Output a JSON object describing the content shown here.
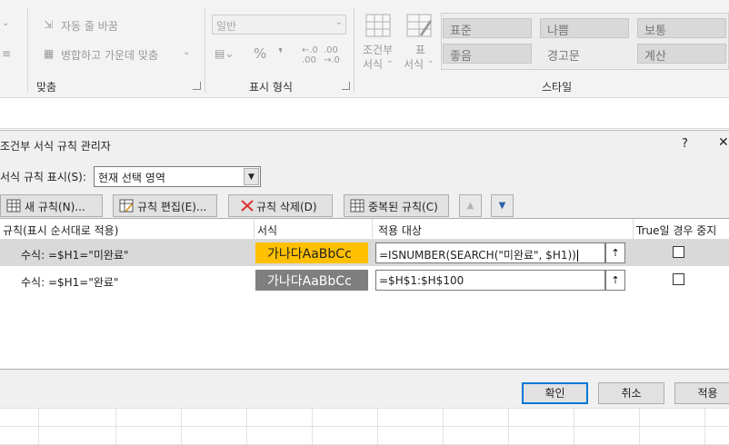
{
  "ribbon": {
    "alignment": {
      "wrap_text": "자동 줄 바꿈",
      "merge_center": "병합하고 가운데 맞춤",
      "group_label": "맞춤"
    },
    "number": {
      "format_value": "일반",
      "percent_symbol": "%",
      "comma_symbol": "❜",
      "group_label": "표시 형식"
    },
    "styles": {
      "conditional_format_line1": "조건부",
      "conditional_format_line2": "서식",
      "format_table_line1": "표",
      "format_table_line2": "서식",
      "gallery": [
        "표준",
        "나쁨",
        "보통",
        "좋음",
        "경고문",
        "계산"
      ],
      "group_label": "스타일"
    }
  },
  "dialog": {
    "title": "조건부 서식 규칙 관리자",
    "help": "?",
    "close": "✕",
    "show_rules_label": "서식 규칙 표시(S):",
    "show_rules_value": "현재 선택 영역",
    "toolbar": {
      "new_rule": "새 규칙(N)...",
      "edit_rule": "규칙 편집(E)...",
      "delete_rule": "규칙 삭제(D)",
      "duplicate_rule": "중복된 규칙(C)"
    },
    "columns": {
      "rule": "규칙(표시 순서대로 적용)",
      "format": "서식",
      "applies_to": "적용 대상",
      "stop_if_true": "True일 경우 중지"
    },
    "rules": [
      {
        "rule": "수식: =$H1=\"미완료\"",
        "preview": "가나다AaBbCc",
        "applies_to": "=ISNUMBER(SEARCH(\"미완료\", $H1))",
        "stop_if_true": false,
        "preview_bg": "#ffc000",
        "preview_fg": "#222222",
        "selected": true
      },
      {
        "rule": "수식: =$H1=\"완료\"",
        "preview": "가나다AaBbCc",
        "applies_to": "=$H$1:$H$100",
        "stop_if_true": false,
        "preview_bg": "#7f7f7f",
        "preview_fg": "#ffffff",
        "selected": false
      }
    ],
    "buttons": {
      "ok": "확인",
      "cancel": "취소",
      "apply": "적용"
    }
  },
  "colors": {
    "dialog_bg": "#f0f0f0",
    "accent": "#0078d7",
    "selected_row": "#d9d9d9"
  }
}
